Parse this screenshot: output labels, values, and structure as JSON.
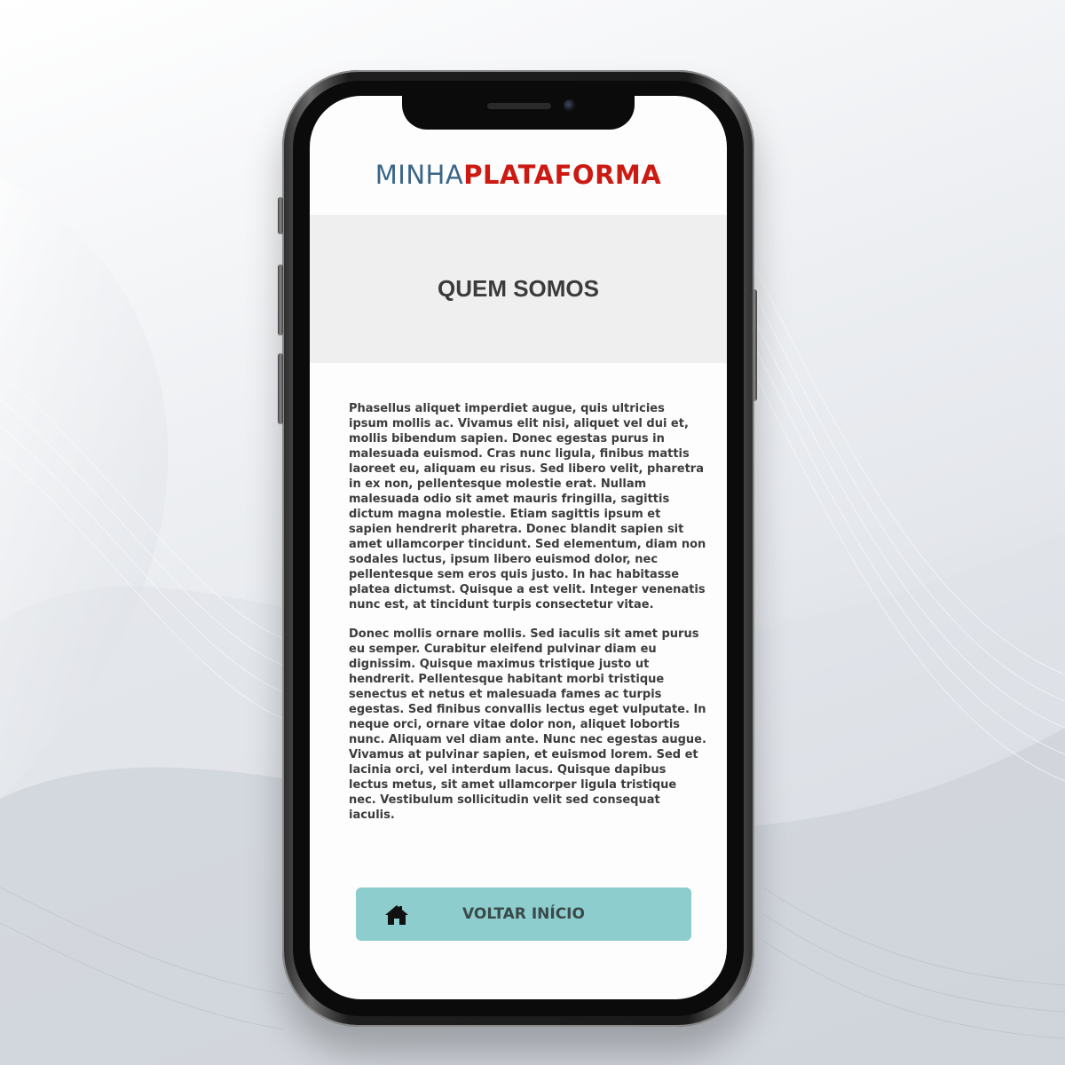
{
  "brand": {
    "part1": "MINHA",
    "part2": "PLATAFORMA",
    "colors": {
      "part1": "#3a6587",
      "part2": "#cc1a12"
    }
  },
  "hero": {
    "title": "QUEM SOMOS"
  },
  "content": {
    "paragraphs": [
      "Phasellus aliquet imperdiet augue, quis ultricies ipsum mollis ac. Vivamus elit nisi, aliquet vel dui et, mollis bibendum sapien. Donec egestas purus in malesuada euismod. Cras nunc ligula, finibus mattis laoreet eu, aliquam eu risus. Sed libero velit, pharetra in ex non, pellentesque molestie erat. Nullam malesuada odio sit amet mauris fringilla, sagittis dictum magna molestie. Etiam sagittis ipsum et sapien hendrerit pharetra. Donec blandit sapien sit amet ullamcorper tincidunt. Sed elementum, diam non sodales luctus, ipsum libero euismod dolor, nec pellentesque sem eros quis justo. In hac habitasse platea dictumst. Quisque a est velit. Integer venenatis nunc est, at tincidunt turpis consectetur vitae.",
      "Donec mollis ornare mollis. Sed iaculis sit amet purus eu semper. Curabitur eleifend pulvinar diam eu dignissim. Quisque maximus tristique justo ut hendrerit. Pellentesque habitant morbi tristique senectus et netus et malesuada fames ac turpis egestas. Sed finibus convallis lectus eget vulputate. In neque orci, ornare vitae dolor non, aliquet lobortis nunc. Aliquam vel diam ante. Nunc nec egestas augue. Vivamus at pulvinar sapien, et euismod lorem. Sed et lacinia orci, vel interdum lacus. Quisque dapibus lectus metus, sit amet ullamcorper ligula tristique nec. Vestibulum sollicitudin velit sed consequat iaculis."
    ]
  },
  "home_button": {
    "label": "VOLTAR INÍCIO",
    "icon": "home-icon",
    "color": "#8ecdcd"
  }
}
